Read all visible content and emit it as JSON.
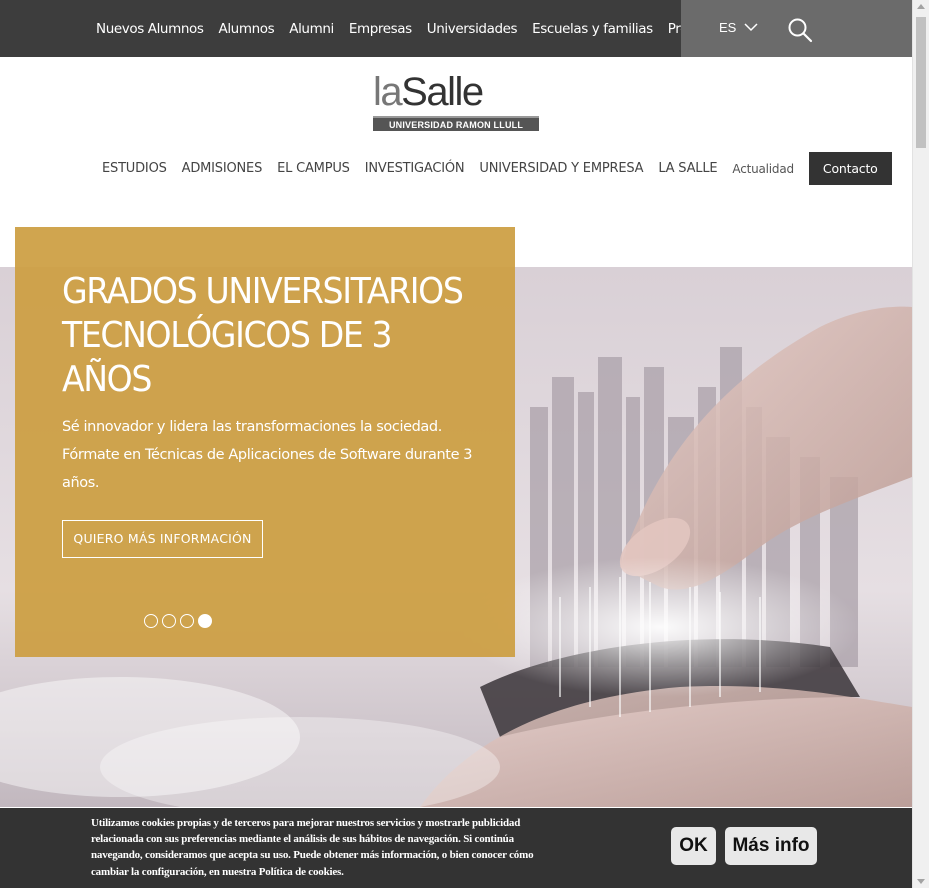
{
  "topnav": {
    "items": [
      "Nuevos Alumnos",
      "Alumnos",
      "Alumni",
      "Empresas",
      "Universidades",
      "Escuelas y familias",
      "Prensa"
    ],
    "language": "ES"
  },
  "logo": {
    "part_la": "la",
    "part_salle": "Salle",
    "subtitle": "UNIVERSIDAD RAMON LLULL"
  },
  "mainnav": {
    "items": [
      "ESTUDIOS",
      "ADMISIONES",
      "EL CAMPUS",
      "INVESTIGACIÓN",
      "UNIVERSIDAD Y EMPRESA",
      "LA SALLE"
    ],
    "news": "Actualidad",
    "contact": "Contacto"
  },
  "hero": {
    "title": "GRADOS UNIVERSITARIOS TECNOLÓGICOS DE 3 AÑOS",
    "description": "Sé innovador y lidera las transformaciones la sociedad. Fórmate en Técnicas de Aplicaciones de Software durante 3 años.",
    "cta": "QUIERO MÁS INFORMACIÓN",
    "slides_total": 4,
    "slide_active": 4
  },
  "cookie": {
    "text": "Utilizamos cookies propias y de terceros para mejorar nuestros servicios y mostrarle publicidad relacionada con sus preferencias mediante el análisis de sus hábitos de navegación. Si continúa navegando, consideramos que acepta su uso. Puede obtener más información, o bien conocer cómo cambiar la configuración, en nuestra Política de cookies.",
    "ok": "OK",
    "more": "Más info"
  },
  "colors": {
    "topbar": "#3d3d3d",
    "panel": "#cc9e42",
    "cookie_bar": "#333333"
  }
}
